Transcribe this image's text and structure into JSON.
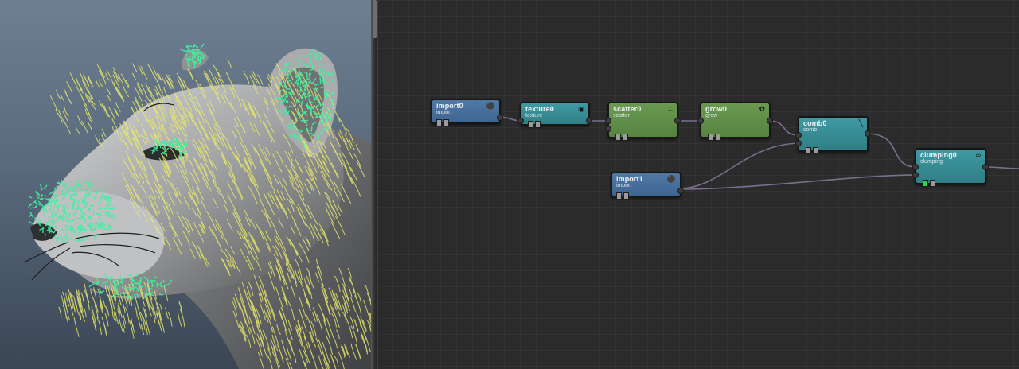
{
  "graph": {
    "nodes": [
      {
        "id": "import0",
        "name": "import0",
        "type": "import",
        "icon": "wand-icon",
        "color": "#4670a0"
      },
      {
        "id": "texture0",
        "name": "texture0",
        "type": "texture",
        "icon": "eye-icon",
        "color": "#3a929a"
      },
      {
        "id": "scatter0",
        "name": "scatter0",
        "type": "scatter",
        "icon": "dots-icon",
        "color": "#629047"
      },
      {
        "id": "grow0",
        "name": "grow0",
        "type": "grow",
        "icon": "sprout-icon",
        "color": "#629047"
      },
      {
        "id": "comb0",
        "name": "comb0",
        "type": "comb",
        "icon": "brush-icon",
        "color": "#3a929a"
      },
      {
        "id": "import1",
        "name": "import1",
        "type": "import",
        "icon": "wand-icon",
        "color": "#4670a0"
      },
      {
        "id": "clumping0",
        "name": "clumping0",
        "type": "clumping",
        "icon": "glasses-icon",
        "color": "#3a929a"
      }
    ]
  },
  "viewport": {
    "subject": "3d-animal-head-with-hair-guides",
    "colors": {
      "hair": "#e8e86a",
      "guides": "#3af5a0",
      "background": "#5f7083"
    }
  },
  "colors": {
    "node_blue": "#4670a0",
    "node_teal": "#3a929a",
    "node_green": "#629047",
    "wire": "#7a6f8c",
    "enabled": "#31d24a",
    "graph_bg": "#2b2b2b"
  }
}
